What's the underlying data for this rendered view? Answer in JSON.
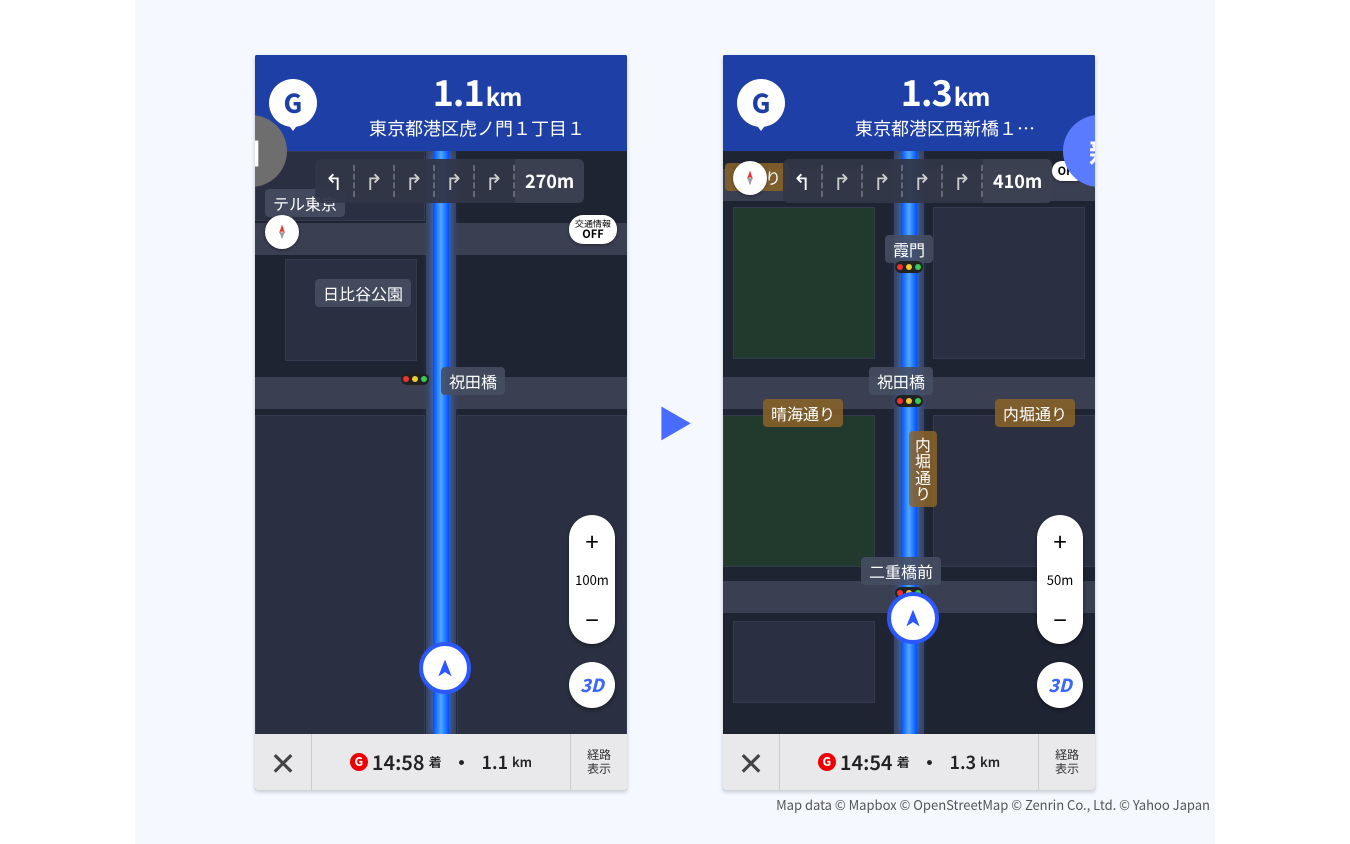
{
  "label_old": "旧",
  "label_new": "新",
  "attribution": "Map data © Mapbox © OpenStreetMap © Zenrin Co., Ltd.    © Yahoo Japan",
  "old": {
    "g_letter": "G",
    "distance_value": "1.1",
    "distance_unit": "km",
    "address": "東京都港区虎ノ門１丁目１",
    "lane_distance": "270m",
    "traffic_line1": "交通情報",
    "traffic_line2": "OFF",
    "zoom_label": "100m",
    "btn3d": "3D",
    "poi_park": "日比谷公園",
    "poi_bridge": "祝田橋",
    "poi_hotel": "テル東京",
    "eta_time": "14:58",
    "eta_suffix": "着",
    "eta_dist_value": "1.1",
    "eta_dist_unit": "km",
    "route_btn_l1": "経路",
    "route_btn_l2": "表示"
  },
  "new": {
    "g_letter": "G",
    "distance_value": "1.3",
    "distance_unit": "km",
    "address": "東京都港区西新橋１…",
    "lane_distance": "410m",
    "traffic_line2": "OFF",
    "zoom_label": "50m",
    "btn3d": "3D",
    "poi_bridge": "祝田橋",
    "poi_kasumi": "霞門",
    "poi_nijubashi": "二重橋前",
    "poi_harumi": "晴海通り",
    "poi_uchibori1": "内堀通り",
    "poi_uchibori2": "内堀通り",
    "poi_hibiyadori": "谷通り",
    "eta_time": "14:54",
    "eta_suffix": "着",
    "eta_dist_value": "1.3",
    "eta_dist_unit": "km",
    "route_btn_l1": "経路",
    "route_btn_l2": "表示"
  }
}
